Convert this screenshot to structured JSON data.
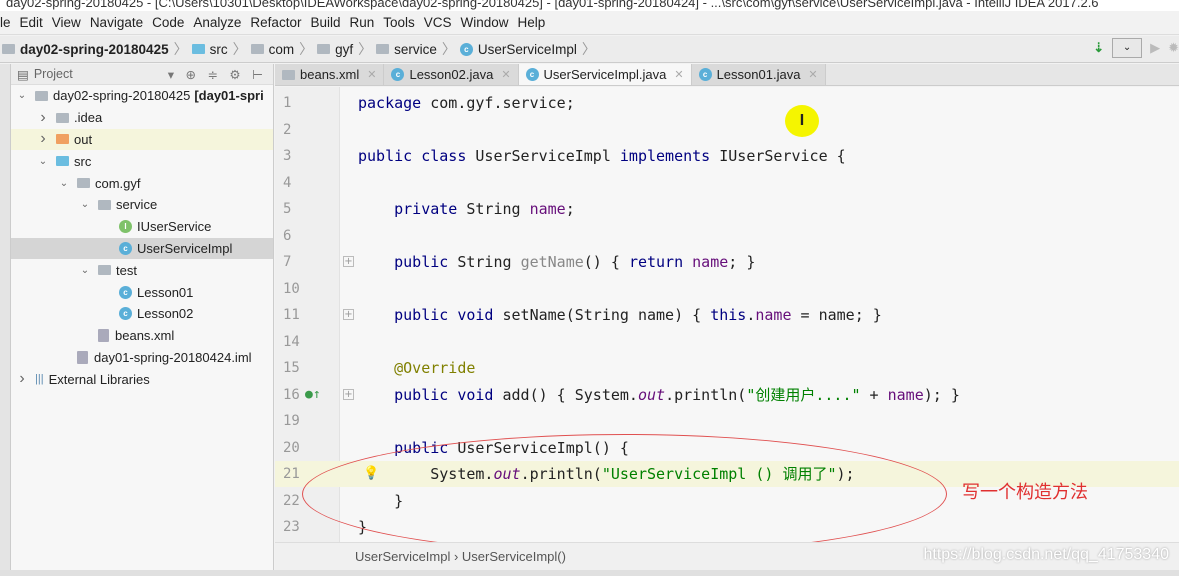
{
  "window": {
    "title": "day02-spring-20180425 - [C:\\Users\\10301\\Desktop\\IDEAWorkspace\\day02-spring-20180425] - [day01-spring-20180424] - ...\\src\\com\\gyf\\service\\UserServiceImpl.java - IntelliJ IDEA 2017.2.6"
  },
  "menu": [
    "ile",
    "Edit",
    "View",
    "Navigate",
    "Code",
    "Analyze",
    "Refactor",
    "Build",
    "Run",
    "Tools",
    "VCS",
    "Window",
    "Help"
  ],
  "breadcrumb": [
    "day02-spring-20180425",
    "src",
    "com",
    "gyf",
    "service",
    "UserServiceImpl"
  ],
  "project": {
    "title": "Project",
    "tree": [
      {
        "label": "day02-spring-20180425",
        "bold": "[day01-spri",
        "indent": 0,
        "arrow": "v",
        "icon": "module"
      },
      {
        "label": ".idea",
        "indent": 1,
        "arrow": ">",
        "icon": "folder"
      },
      {
        "label": "out",
        "indent": 1,
        "arrow": ">",
        "icon": "folder-orange"
      },
      {
        "label": "src",
        "indent": 1,
        "arrow": "v",
        "icon": "folder-blue"
      },
      {
        "label": "com.gyf",
        "indent": 2,
        "arrow": "v",
        "icon": "package"
      },
      {
        "label": "service",
        "indent": 3,
        "arrow": "v",
        "icon": "package"
      },
      {
        "label": "IUserService",
        "indent": 4,
        "arrow": "",
        "icon": "interface"
      },
      {
        "label": "UserServiceImpl",
        "indent": 4,
        "arrow": "",
        "icon": "class",
        "selected": true
      },
      {
        "label": "test",
        "indent": 3,
        "arrow": "v",
        "icon": "package"
      },
      {
        "label": "Lesson01",
        "indent": 4,
        "arrow": "",
        "icon": "class"
      },
      {
        "label": "Lesson02",
        "indent": 4,
        "arrow": "",
        "icon": "class"
      },
      {
        "label": "beans.xml",
        "indent": 3,
        "arrow": "",
        "icon": "xml"
      },
      {
        "label": "day01-spring-20180424.iml",
        "indent": 2,
        "arrow": "",
        "icon": "file"
      },
      {
        "label": "External Libraries",
        "indent": 0,
        "arrow": ">",
        "icon": "library"
      }
    ]
  },
  "tabs": [
    {
      "label": "beans.xml",
      "active": false
    },
    {
      "label": "Lesson02.java",
      "active": false
    },
    {
      "label": "UserServiceImpl.java",
      "active": true
    },
    {
      "label": "Lesson01.java",
      "active": false
    }
  ],
  "code": [
    {
      "n": "1",
      "t": [
        [
          "package ",
          "kw"
        ],
        [
          "com.gyf.service;",
          ""
        ]
      ]
    },
    {
      "n": "2",
      "t": []
    },
    {
      "n": "3",
      "t": [
        [
          "public class ",
          "kw"
        ],
        [
          "UserServiceImpl ",
          ""
        ],
        [
          "implements ",
          "kw"
        ],
        [
          "IUserService {",
          ""
        ]
      ]
    },
    {
      "n": "4",
      "t": []
    },
    {
      "n": "5",
      "t": [
        [
          "    private ",
          "kw"
        ],
        [
          "String ",
          ""
        ],
        [
          "name",
          "fld"
        ],
        [
          ";",
          ""
        ]
      ]
    },
    {
      "n": "6",
      "t": []
    },
    {
      "n": "7",
      "fold": true,
      "t": [
        [
          "    public ",
          "kw"
        ],
        [
          "String ",
          ""
        ],
        [
          "getName",
          "mth"
        ],
        [
          "() { ",
          ""
        ],
        [
          "return ",
          "kw"
        ],
        [
          "name",
          "fld"
        ],
        [
          "; }",
          ""
        ]
      ]
    },
    {
      "n": "10",
      "t": []
    },
    {
      "n": "11",
      "fold": true,
      "t": [
        [
          "    public void ",
          "kw"
        ],
        [
          "setName(String name) { ",
          ""
        ],
        [
          "this",
          "kw"
        ],
        [
          ".",
          ""
        ],
        [
          "name",
          "fld"
        ],
        [
          " = name; }",
          ""
        ]
      ]
    },
    {
      "n": "14",
      "t": []
    },
    {
      "n": "15",
      "t": [
        [
          "    @Override",
          "ann"
        ]
      ]
    },
    {
      "n": "16",
      "fold": true,
      "t": [
        [
          "    public void ",
          "kw"
        ],
        [
          "add() { System.",
          ""
        ],
        [
          "out",
          "it"
        ],
        [
          ".println(",
          ""
        ],
        [
          "\"创建用户....\"",
          "str"
        ],
        [
          " + ",
          ""
        ],
        [
          "name",
          "fld"
        ],
        [
          "); }",
          ""
        ]
      ]
    },
    {
      "n": "19",
      "t": []
    },
    {
      "n": "20",
      "t": [
        [
          "    public ",
          "kw"
        ],
        [
          "UserServiceImpl() {",
          ""
        ]
      ]
    },
    {
      "n": "21",
      "cur": true,
      "t": [
        [
          "        System.",
          ""
        ],
        [
          "out",
          "it"
        ],
        [
          ".println(",
          ""
        ],
        [
          "\"UserServiceImpl () 调用了\"",
          "str"
        ],
        [
          ");",
          ""
        ]
      ]
    },
    {
      "n": "22",
      "t": [
        [
          "    }",
          ""
        ]
      ]
    },
    {
      "n": "23",
      "t": [
        [
          "}",
          ""
        ]
      ]
    }
  ],
  "editor_breadcrumb": "UserServiceImpl › UserServiceImpl()",
  "annotation": "写一个构造方法",
  "cursor_marker": "I",
  "watermark": "https://blog.csdn.net/qq_41753340"
}
